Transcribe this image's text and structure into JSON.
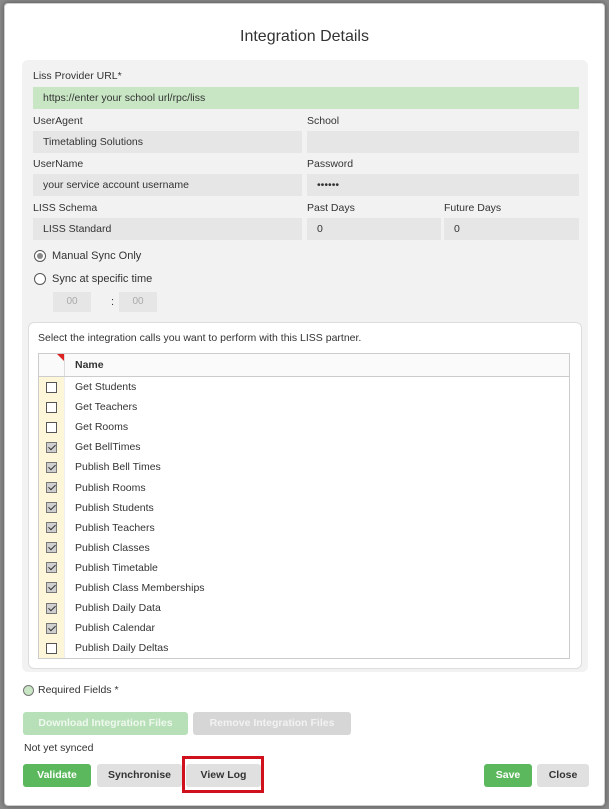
{
  "dialog": {
    "title": "Integration Details"
  },
  "form": {
    "provider_url": {
      "label": "Liss Provider URL*",
      "value": "https://enter your school url/rpc/liss"
    },
    "user_agent": {
      "label": "UserAgent",
      "value": "Timetabling Solutions"
    },
    "school": {
      "label": "School",
      "value": ""
    },
    "username": {
      "label": "UserName",
      "value": "your service account username"
    },
    "password": {
      "label": "Password",
      "value": "••••••"
    },
    "schema": {
      "label": "LISS Schema",
      "value": "LISS Standard"
    },
    "past_days": {
      "label": "Past Days",
      "value": "0"
    },
    "future_days": {
      "label": "Future Days",
      "value": "0"
    },
    "sync_manual": {
      "label": "Manual Sync Only",
      "checked": true
    },
    "sync_specific": {
      "label": "Sync at specific time",
      "checked": false
    },
    "time": {
      "hours_placeholder": "00",
      "separator": ":",
      "minutes_placeholder": "00"
    }
  },
  "calls": {
    "description": "Select the integration calls you want to perform with this LISS partner.",
    "column_name": "Name",
    "items": [
      {
        "label": "Get Students",
        "checked": false
      },
      {
        "label": "Get Teachers",
        "checked": false
      },
      {
        "label": "Get Rooms",
        "checked": false
      },
      {
        "label": "Get BellTimes",
        "checked": true
      },
      {
        "label": "Publish Bell Times",
        "checked": true
      },
      {
        "label": "Publish Rooms",
        "checked": true
      },
      {
        "label": "Publish Students",
        "checked": true
      },
      {
        "label": "Publish Teachers",
        "checked": true
      },
      {
        "label": "Publish Classes",
        "checked": true
      },
      {
        "label": "Publish Timetable",
        "checked": true
      },
      {
        "label": "Publish Class Memberships",
        "checked": true
      },
      {
        "label": "Publish Daily Data",
        "checked": true
      },
      {
        "label": "Publish Calendar",
        "checked": true
      },
      {
        "label": "Publish Daily Deltas",
        "checked": false
      }
    ]
  },
  "required_label": "Required Fields *",
  "buttons": {
    "download": "Download Integration Files",
    "remove": "Remove Integration Files",
    "validate": "Validate",
    "synchronise": "Synchronise",
    "view_log": "View Log",
    "save": "Save",
    "close": "Close"
  },
  "status": "Not yet synced",
  "colors": {
    "accent_green": "#5cb85c",
    "field_green": "#c8e6c4",
    "highlight_red": "#d0101a"
  }
}
